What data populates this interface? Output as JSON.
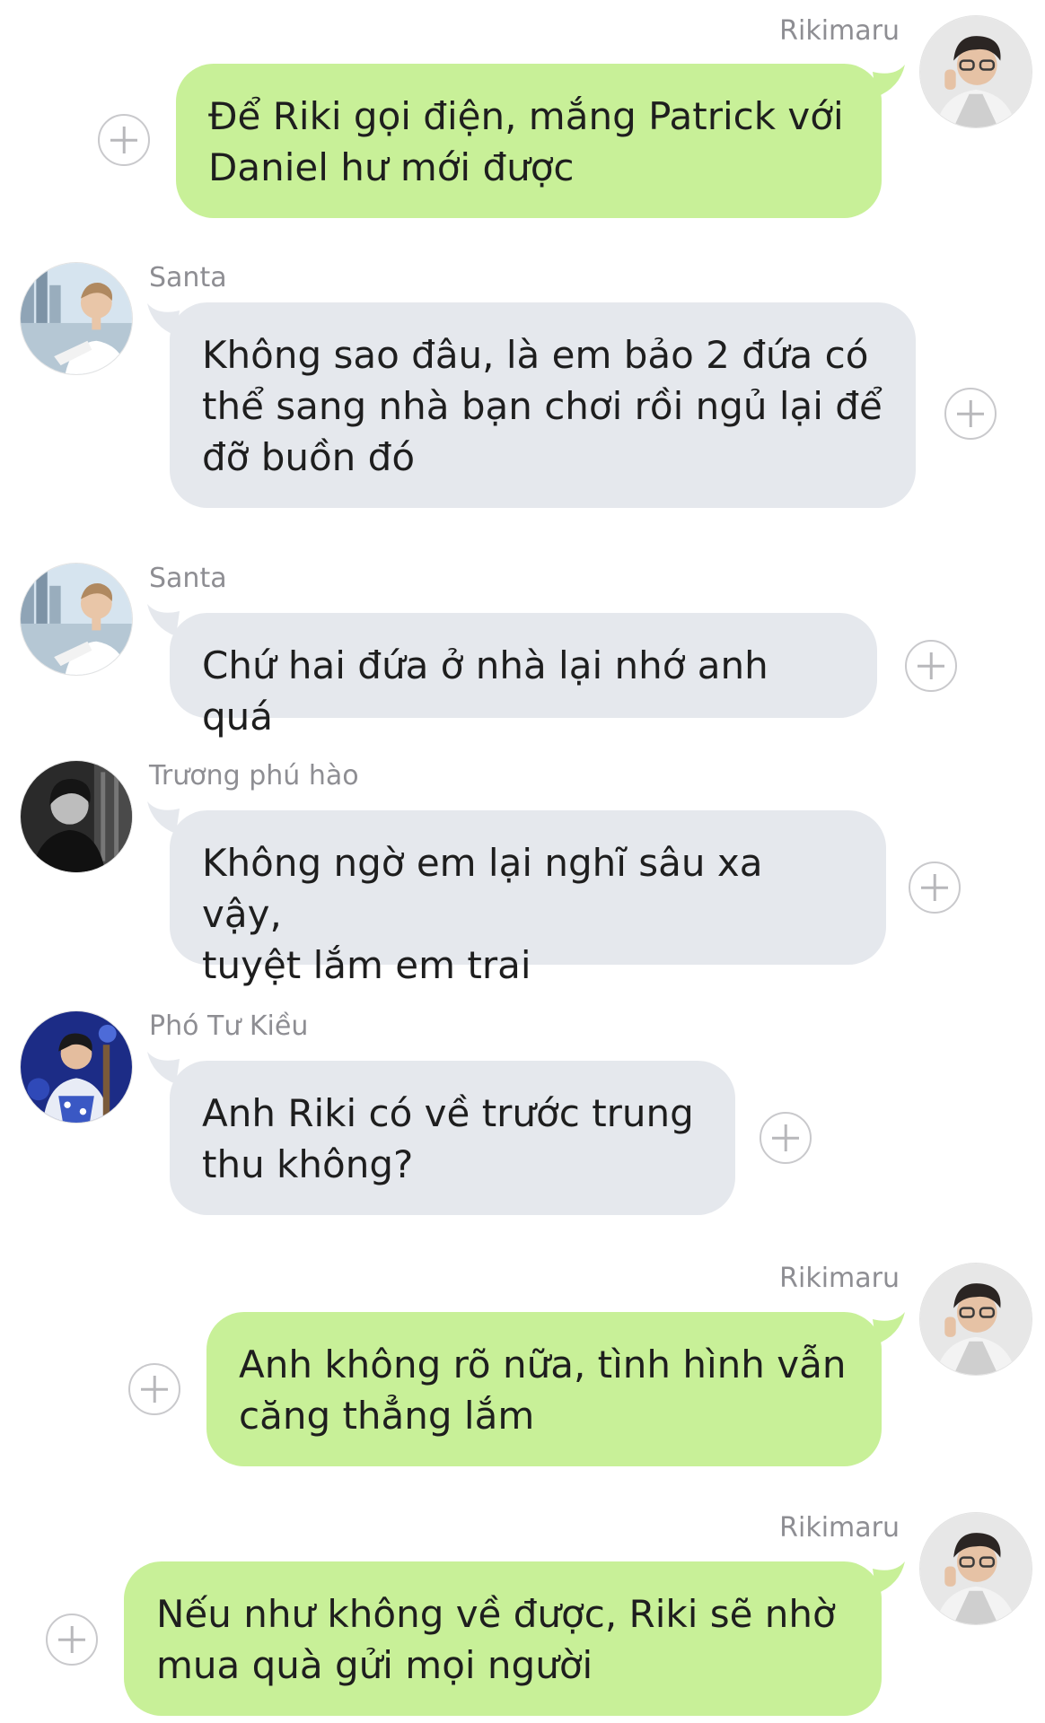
{
  "messages": [
    {
      "sender": "Rikimaru",
      "avatar": "avatar-rikimaru",
      "direction": "out",
      "text": "Để Riki gọi điện, mắng Patrick với\nDaniel hư mới được",
      "add_icon": "plus-circle-icon"
    },
    {
      "sender": "Santa",
      "avatar": "avatar-santa",
      "direction": "in",
      "text": "Không sao đâu, là em bảo 2 đứa có\nthể sang nhà bạn chơi rồi ngủ lại để\nđỡ buồn đó",
      "add_icon": "plus-circle-icon"
    },
    {
      "sender": "Santa",
      "avatar": "avatar-santa",
      "direction": "in",
      "text": "Chứ hai đứa ở nhà lại nhớ anh quá",
      "add_icon": "plus-circle-icon"
    },
    {
      "sender": "Trương phú hào",
      "avatar": "avatar-truong-phu-hao",
      "direction": "in",
      "text": "Không ngờ em lại nghĩ sâu xa vậy,\ntuyệt lắm em trai",
      "add_icon": "plus-circle-icon"
    },
    {
      "sender": "Phó Tư Kiều",
      "avatar": "avatar-pho-tu-kieu",
      "direction": "in",
      "text": "Anh Riki có về trước trung\nthu không?",
      "add_icon": "plus-circle-icon"
    },
    {
      "sender": "Rikimaru",
      "avatar": "avatar-rikimaru",
      "direction": "out",
      "text": "Anh không rõ nữa, tình hình vẫn\ncăng thẳng lắm",
      "add_icon": "plus-circle-icon"
    },
    {
      "sender": "Rikimaru",
      "avatar": "avatar-rikimaru",
      "direction": "out",
      "text": "Nếu như không về được, Riki sẽ nhờ\nmua quà gửi mọi người",
      "add_icon": "plus-circle-icon"
    }
  ],
  "colors": {
    "incoming_bubble": "#e5e8ed",
    "outgoing_bubble": "#c8f098",
    "sender_name": "#8e8e93",
    "message_text": "#1e1e1e"
  }
}
